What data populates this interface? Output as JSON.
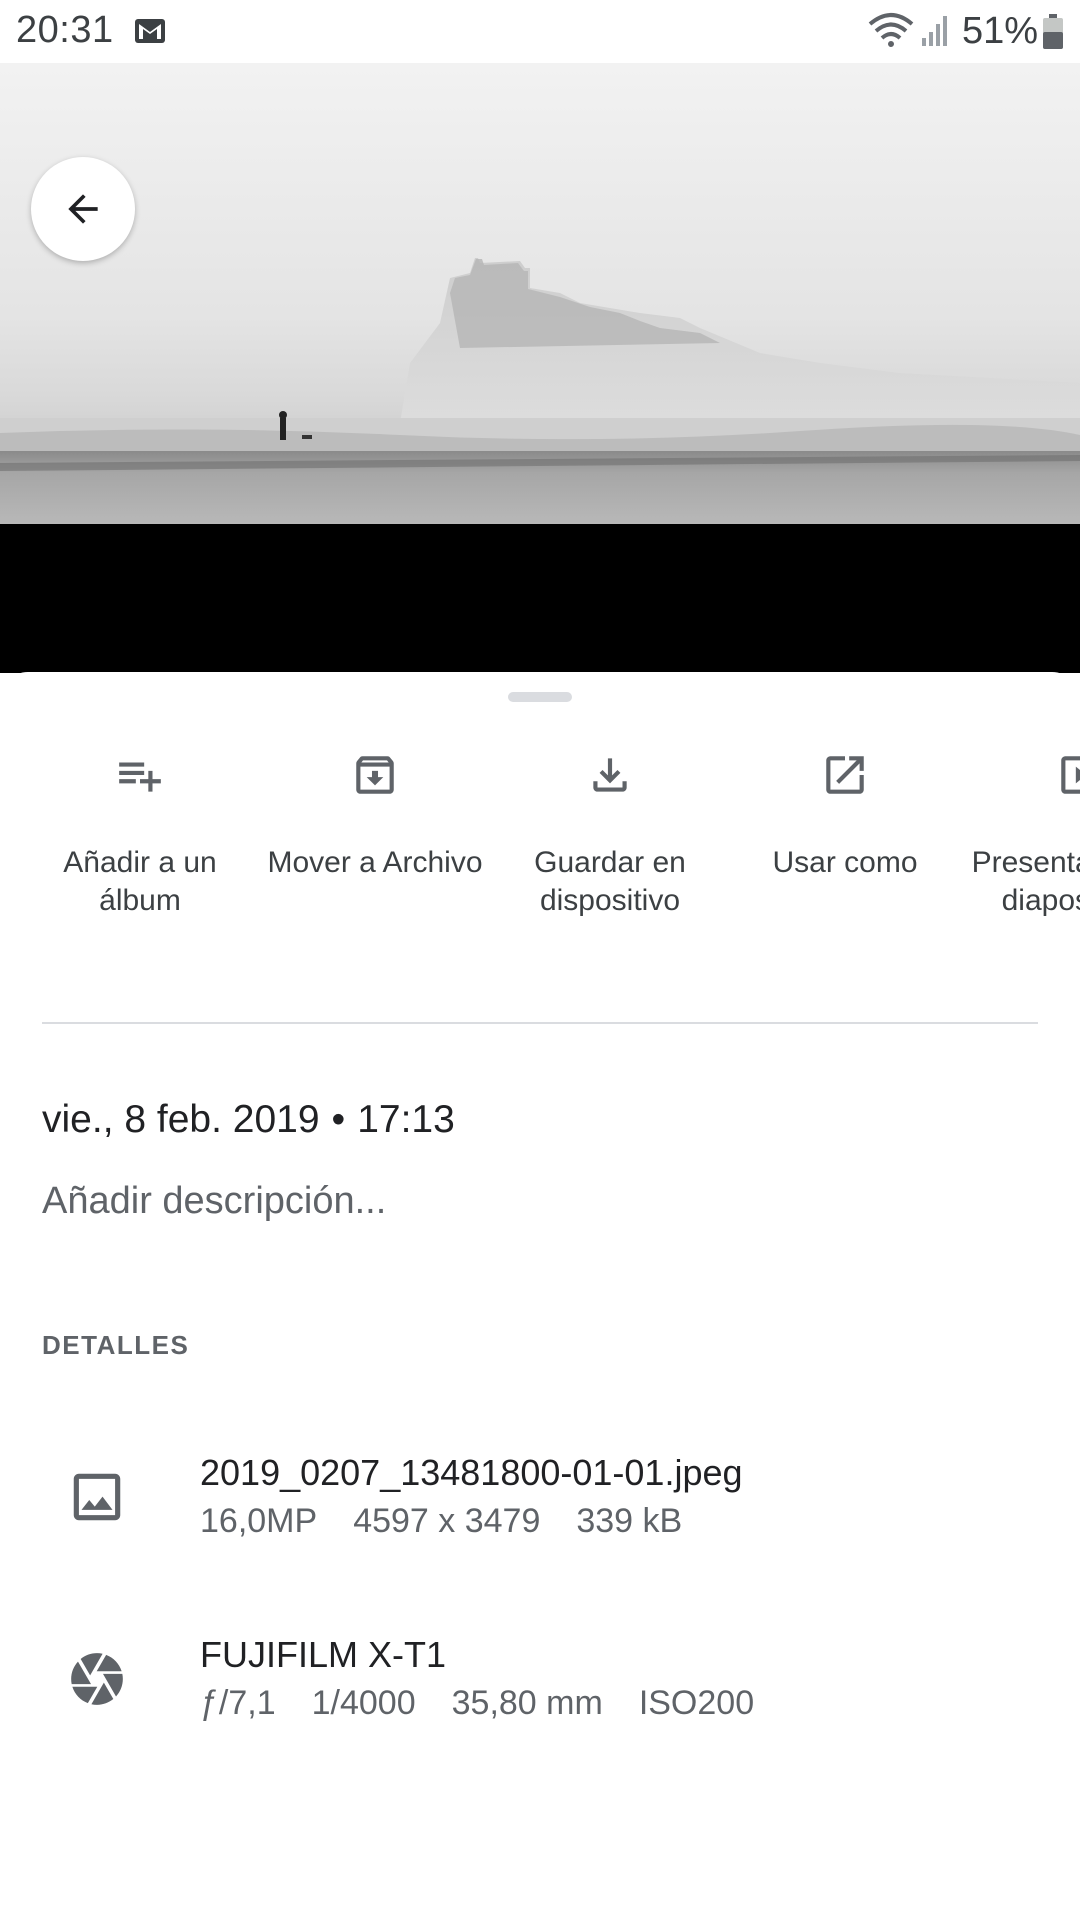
{
  "status_bar": {
    "time": "20:31",
    "battery": "51%",
    "icons": [
      "gmail-icon",
      "wifi-icon",
      "signal-icon",
      "battery-icon"
    ]
  },
  "photo": {
    "description_icon": "image"
  },
  "actions": [
    {
      "icon": "playlist-add-icon",
      "label": "Añadir a un álbum"
    },
    {
      "icon": "archive-icon",
      "label": "Mover a Archivo"
    },
    {
      "icon": "download-icon",
      "label": "Guardar en dispositivo"
    },
    {
      "icon": "open-in-new-icon",
      "label": "Usar como"
    },
    {
      "icon": "slideshow-icon",
      "label": "Presentación de diapositivas"
    }
  ],
  "info": {
    "date": "vie., 8 feb. 2019",
    "separator": "•",
    "time": "17:13",
    "description_placeholder": "Añadir descripción..."
  },
  "details": {
    "header": "DETALLES",
    "file": {
      "name": "2019_0207_13481800-01-01.jpeg",
      "megapixels": "16,0MP",
      "resolution": "4597 x 3479",
      "size": "339 kB"
    },
    "camera": {
      "model": "FUJIFILM X-T1",
      "aperture": "ƒ/7,1",
      "shutter": "1/4000",
      "focal_length": "35,80 mm",
      "iso": "ISO200"
    }
  }
}
